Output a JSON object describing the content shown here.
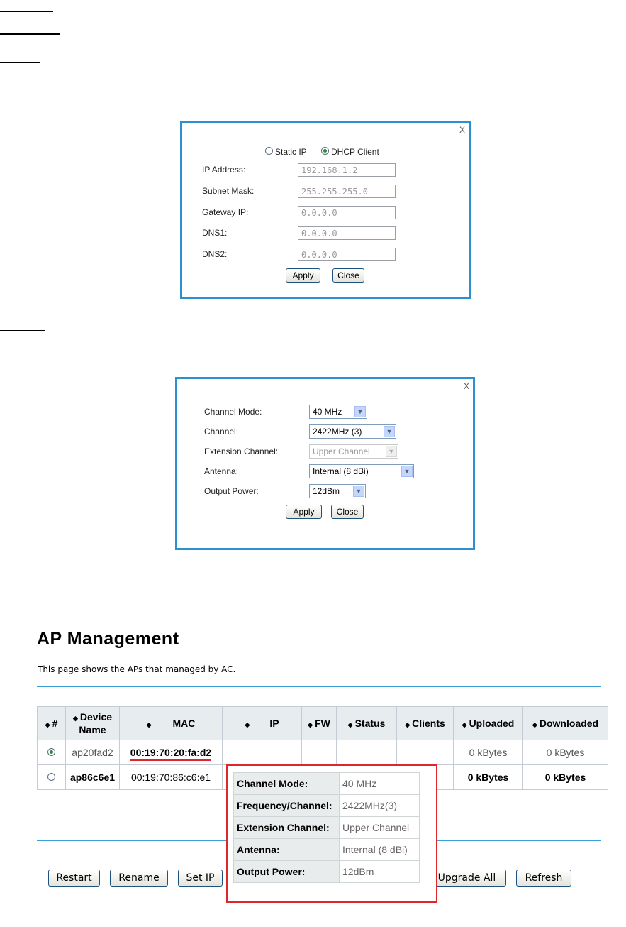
{
  "ip_dialog": {
    "close": "X",
    "mode_static": "Static IP",
    "mode_dhcp": "DHCP Client",
    "selected_mode": "DHCP Client",
    "fields": [
      {
        "label": "IP Address:",
        "value": "192.168.1.2"
      },
      {
        "label": "Subnet Mask:",
        "value": "255.255.255.0"
      },
      {
        "label": "Gateway IP:",
        "value": "0.0.0.0"
      },
      {
        "label": "DNS1:",
        "value": "0.0.0.0"
      },
      {
        "label": "DNS2:",
        "value": "0.0.0.0"
      }
    ],
    "apply": "Apply",
    "cancel": "Close"
  },
  "radio_dialog": {
    "close": "X",
    "rows": [
      {
        "label": "Channel Mode:",
        "value": "40 MHz"
      },
      {
        "label": "Channel:",
        "value": "2422MHz (3)"
      },
      {
        "label": "Extension Channel:",
        "value": "Upper Channel"
      },
      {
        "label": "Antenna:",
        "value": "Internal (8 dBi)"
      },
      {
        "label": "Output Power:",
        "value": "12dBm"
      }
    ],
    "apply": "Apply",
    "cancel": "Close"
  },
  "ap": {
    "title": "AP Management",
    "subtitle": "This page shows the APs that managed by AC.",
    "columns": [
      "#",
      "Device Name",
      "MAC",
      "IP",
      "FW",
      "Status",
      "Clients",
      "Uploaded",
      "Downloaded"
    ],
    "rows": [
      {
        "name": "ap20fad2",
        "mac": "00:19:70:20:fa:d2",
        "uploaded": "0 kBytes",
        "downloaded": "0 kBytes",
        "selected": true
      },
      {
        "name": "ap86c6e1",
        "mac": "00:19:70:86:c6:e1",
        "uploaded": "0 kBytes",
        "downloaded": "0 kBytes",
        "selected": false
      }
    ],
    "popup": [
      {
        "label": "Channel Mode:",
        "value": "40 MHz"
      },
      {
        "label": "Frequency/Channel:",
        "value": "2422MHz(3)"
      },
      {
        "label": "Extension Channel:",
        "value": "Upper Channel"
      },
      {
        "label": "Antenna:",
        "value": "Internal (8 dBi)"
      },
      {
        "label": "Output Power:",
        "value": "12dBm"
      }
    ],
    "buttons": {
      "restart": "Restart",
      "rename": "Rename",
      "set_ip": "Set IP",
      "upgrade_all": "Upgrade All",
      "refresh": "Refresh"
    }
  },
  "colors": {
    "dialog_border": "#2e8fcf",
    "rule": "#37a1d3",
    "highlight": "#e0262d"
  }
}
